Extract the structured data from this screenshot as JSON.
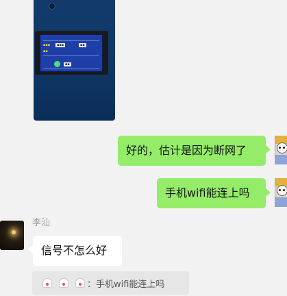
{
  "conversation": {
    "messages": [
      {
        "sender": "me",
        "type": "image",
        "description_icon": "photo-message"
      },
      {
        "sender": "me",
        "type": "text",
        "text": "好的，估计是因为断网了"
      },
      {
        "sender": "me",
        "type": "text",
        "text": "手机wifi能连上吗"
      },
      {
        "sender": "other",
        "type": "text",
        "sender_name": "李汕",
        "text": "信号不怎么好"
      }
    ],
    "quote": {
      "text": "：手机wifi能连上吗",
      "emoji_icon": "ghost-emoji-icon"
    }
  },
  "colors": {
    "background": "#f2f2f2",
    "my_bubble": "#95ec69",
    "their_bubble": "#ffffff",
    "quote_bg": "#e6e6e6"
  }
}
